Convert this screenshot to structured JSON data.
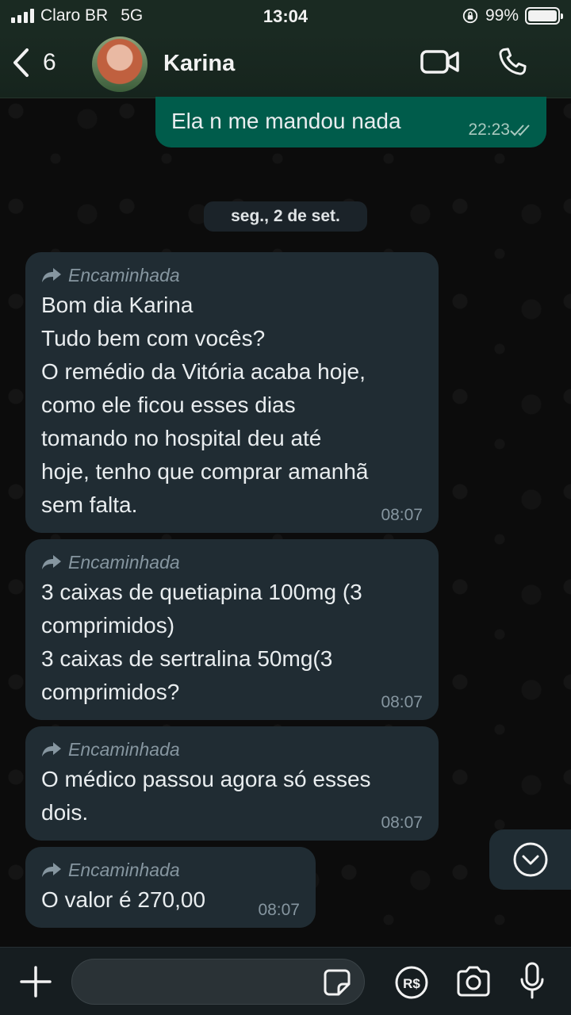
{
  "status_bar": {
    "carrier": "Claro BR",
    "network": "5G",
    "time": "13:04",
    "battery": "99%",
    "battery_level": 0.99
  },
  "header": {
    "back_count": "6",
    "contact_name": "Karina"
  },
  "outgoing_message": {
    "text": "Ela n me mandou nada",
    "time": "22:23"
  },
  "date_separator": "seg., 2 de set.",
  "forwarded_label": "Encaminhada",
  "messages": [
    {
      "text": "Bom dia Karina\nTudo bem com vocês?\nO remédio da Vitória acaba hoje,\ncomo ele ficou esses dias\ntomando no hospital deu até\nhoje, tenho que comprar amanhã\nsem falta.",
      "time": "08:07"
    },
    {
      "text": "3 caixas de quetiapina 100mg (3\ncomprimidos)\n3 caixas de sertralina 50mg(3\ncomprimidos?",
      "time": "08:07"
    },
    {
      "text": "O médico passou agora só esses\ndois.",
      "time": "08:07"
    },
    {
      "text": "O valor é 270,00",
      "time": "08:07"
    }
  ],
  "colors": {
    "incoming_bubble": "#202c33",
    "outgoing_bubble": "#005c4b",
    "meta_text": "#8696a0"
  }
}
